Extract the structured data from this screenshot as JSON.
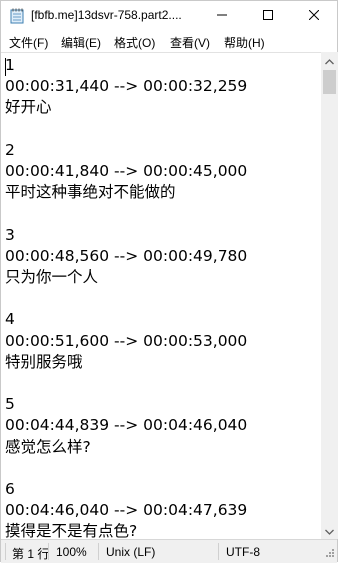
{
  "window": {
    "title": "[fbfb.me]13dsvr-758.part2....",
    "icon": "notepad-icon",
    "controls": [
      "minimize-icon",
      "maximize-icon",
      "close-icon"
    ]
  },
  "menu": {
    "items": [
      "文件(F)",
      "编辑(E)",
      "格式(O)",
      "查看(V)",
      "帮助(H)"
    ]
  },
  "editor": {
    "lines": [
      "1",
      "00:00:31,440 --> 00:00:32,259",
      "好开心",
      "",
      "2",
      "00:00:41,840 --> 00:00:45,000",
      "平时这种事绝对不能做的",
      "",
      "3",
      "00:00:48,560 --> 00:00:49,780",
      "只为你一个人",
      "",
      "4",
      "00:00:51,600 --> 00:00:53,000",
      "特别服务哦",
      "",
      "5",
      "00:04:44,839 --> 00:04:46,040",
      "感觉怎么样?",
      "",
      "6",
      "00:04:46,040 --> 00:04:47,639",
      "摸得是不是有点色?"
    ]
  },
  "status": {
    "position": "第 1 行",
    "zoom": "100%",
    "line_ending": "Unix (LF)",
    "encoding": "UTF-8"
  },
  "colors": {
    "statusbar": "#f0f0f0",
    "scroll_thumb": "#cdcdcd"
  }
}
